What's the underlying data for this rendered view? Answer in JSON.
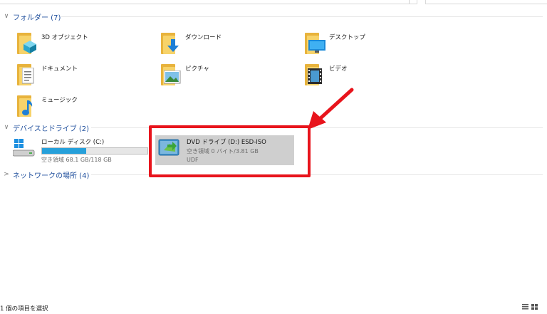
{
  "folders_group": {
    "label": "フォルダー (7)"
  },
  "folders": [
    {
      "name": "3D オブジェクト",
      "icon": "3d-objects-icon"
    },
    {
      "name": "ダウンロード",
      "icon": "downloads-icon"
    },
    {
      "name": "デスクトップ",
      "icon": "desktop-icon"
    },
    {
      "name": "ドキュメント",
      "icon": "documents-icon"
    },
    {
      "name": "ピクチャ",
      "icon": "pictures-icon"
    },
    {
      "name": "ビデオ",
      "icon": "videos-icon"
    },
    {
      "name": "ミュージック",
      "icon": "music-icon"
    }
  ],
  "devices_group": {
    "label": "デバイスとドライブ (2)"
  },
  "drives": {
    "local": {
      "name": "ローカル ディスク (C:)",
      "info": "空き領域 68.1 GB/118 GB",
      "used_fraction": 0.42,
      "icon": "local-disk-icon"
    },
    "dvd": {
      "name": "DVD ドライブ (D:) ESD-ISO",
      "info": "空き領域 0 バイト/3.81 GB",
      "fs": "UDF",
      "icon": "dvd-drive-icon"
    }
  },
  "network_group": {
    "label": "ネットワークの場所 (4)"
  },
  "status": {
    "selection": "1 個の項目を選択"
  },
  "colors": {
    "accent": "#26a0da",
    "highlight": "#e8141c",
    "group_text": "#1e4e9c"
  }
}
